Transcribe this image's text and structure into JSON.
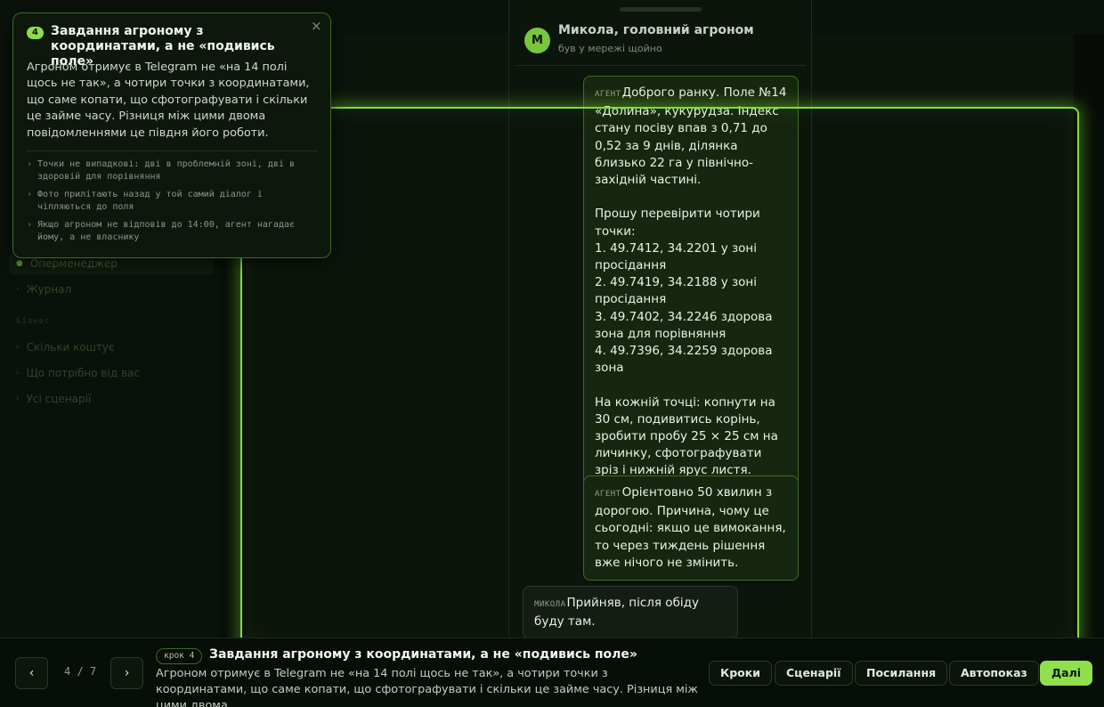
{
  "sidebar": {
    "items_top": [
      {
        "label": "Оперменеджер",
        "active": true
      },
      {
        "label": "Журнал",
        "active": false
      }
    ],
    "section_label": "Бізнес",
    "items_bottom": [
      {
        "label": "Скільки коштує"
      },
      {
        "label": "Що потрібно від вас"
      },
      {
        "label": "Усі сценарії"
      }
    ]
  },
  "chat": {
    "contact_initial": "М",
    "contact_name": "Микола, головний агроном",
    "contact_status": "був у мережі щойно",
    "messages": [
      {
        "sender_tag": "АГЕНТ",
        "text": "Доброго ранку. Поле №14 «Долина», кукурудза. Індекс стану посіву впав з 0,71 до 0,52 за 9 днів, ділянка близько 22 га у північно-західній частині.\n\nПрошу перевірити чотири точки:\n1. 49.7412, 34.2201 у зоні просідання\n2. 49.7419, 34.2188 у зоні просідання\n3. 49.7402, 34.2246 здорова зона для порівняння\n4. 49.7396, 34.2259 здорова зона\n\nНа кожній точці: копнути на 30 см, подивитись корінь, зробити пробу 25 × 25 см на личинку, сфотографувати зріз і нижній ярус листя."
      },
      {
        "sender_tag": "АГЕНТ",
        "text": "Орієнтовно 50 хвилин з дорогою. Причина, чому це сьогодні: якщо це вимокання, то через тиждень рішення вже нічого не змінить."
      },
      {
        "sender_tag": "МИКОЛА",
        "text": "Прийняв, після обіду буду там."
      }
    ]
  },
  "tip": {
    "step_number": "4",
    "title": "Завдання агроному з координатами, а не «подивись поле»",
    "close_icon": "×",
    "body": "Агроном отримує в Telegram не «на 14 полі щось не так», а чотири точки з координатами, що саме копати, що сфотографувати і скільки це займе часу. Різниця між цими двома повідомленнями це півдня його роботи.",
    "points": [
      "Точки не випадкові: дві в проблемній зоні, дві в здоровій для порівняння",
      "Фото прилітають назад у той самий діалог і чіпляються до поля",
      "Якщо агроном не відповів до 14:00, агент нагадає йому, а не власнику"
    ]
  },
  "footer": {
    "prev_icon": "‹",
    "next_icon": "›",
    "counter": "4 / 7",
    "step_pill": "крок 4",
    "title": "Завдання агроному з координатами, а не «подивись поле»",
    "description": "Агроном отримує в Telegram не «на 14 полі щось не так», а чотири точки з координатами, що саме копати, що сфотографувати і скільки це займе часу. Різниця між цими двома…",
    "buttons": {
      "steps": "Кроки",
      "scenarios": "Сценарії",
      "link": "Посилання",
      "autoplay": "Автопоказ",
      "next": "Далі"
    }
  },
  "colors": {
    "accent": "#8fe04e",
    "highlight": "#7be03a",
    "background": "#070c07"
  }
}
